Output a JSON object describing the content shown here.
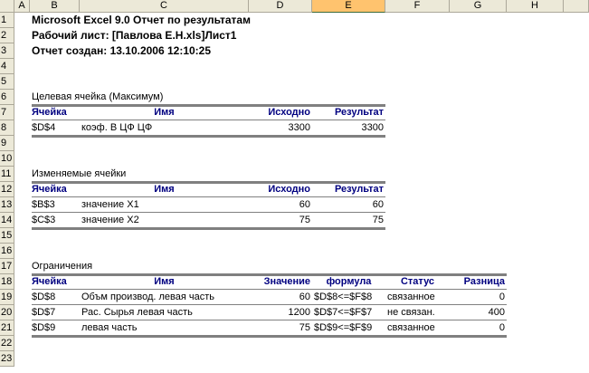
{
  "columns": [
    "A",
    "B",
    "C",
    "D",
    "E",
    "F",
    "G",
    "H"
  ],
  "selected_column": "E",
  "rows": [
    "1",
    "2",
    "3",
    "4",
    "5",
    "6",
    "7",
    "8",
    "9",
    "10",
    "11",
    "12",
    "13",
    "14",
    "15",
    "16",
    "17",
    "18",
    "19",
    "20",
    "21",
    "22",
    "23"
  ],
  "title": "Microsoft Excel 9.0 Отчет по результатам",
  "sheet": "Рабочий лист: [Павлова Е.Н.xls]Лист1",
  "created": "Отчет создан: 13.10.2006 12:10:25",
  "target": {
    "caption": "Целевая ячейка (Максимум)",
    "headers": [
      "Ячейка",
      "Имя",
      "Исходно",
      "Результат"
    ],
    "rows": [
      [
        "$D$4",
        "коэф. В ЦФ ЦФ",
        "3300",
        "3300"
      ]
    ]
  },
  "variables": {
    "caption": "Изменяемые ячейки",
    "headers": [
      "Ячейка",
      "Имя",
      "Исходно",
      "Результат"
    ],
    "rows": [
      [
        "$B$3",
        "значение X1",
        "60",
        "60"
      ],
      [
        "$C$3",
        "значение X2",
        "75",
        "75"
      ]
    ]
  },
  "constraints": {
    "caption": "Ограничения",
    "headers": [
      "Ячейка",
      "Имя",
      "Значение",
      "формула",
      "Статус",
      "Разница"
    ],
    "rows": [
      [
        "$D$8",
        "Объм производ. левая часть",
        "60",
        "$D$8<=$F$8",
        "связанное",
        "0"
      ],
      [
        "$D$7",
        "Рас. Сырья левая часть",
        "1200",
        "$D$7<=$F$7",
        "не связан.",
        "400"
      ],
      [
        "$D$9",
        "левая часть",
        "75",
        "$D$9<=$F$9",
        "связанное",
        "0"
      ]
    ]
  }
}
